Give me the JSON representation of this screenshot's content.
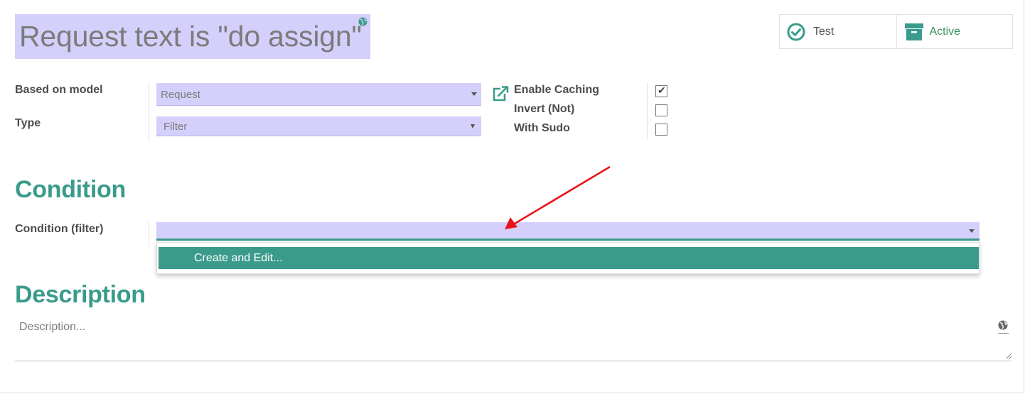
{
  "header": {
    "title": "Request text is \"do assign\""
  },
  "smart_buttons": {
    "test_label": "Test",
    "active_label": "Active"
  },
  "fields": {
    "based_on_model": {
      "label": "Based on model",
      "value": "Request"
    },
    "type": {
      "label": "Type",
      "value": "Filter"
    },
    "enable_caching": {
      "label": "Enable Caching",
      "checked": true
    },
    "invert_not": {
      "label": "Invert (Not)",
      "checked": false
    },
    "with_sudo": {
      "label": "With Sudo",
      "checked": false
    }
  },
  "condition_section": {
    "title": "Condition",
    "field_label": "Condition (filter)",
    "value": "",
    "dropdown_items": [
      "Create and Edit..."
    ]
  },
  "description_section": {
    "title": "Description",
    "placeholder": "Description..."
  },
  "colors": {
    "accent": "#3a9b8b",
    "required_field_bg": "#d4d0fb",
    "active_green": "#3a8f58",
    "annotation_arrow": "#e8141b"
  }
}
